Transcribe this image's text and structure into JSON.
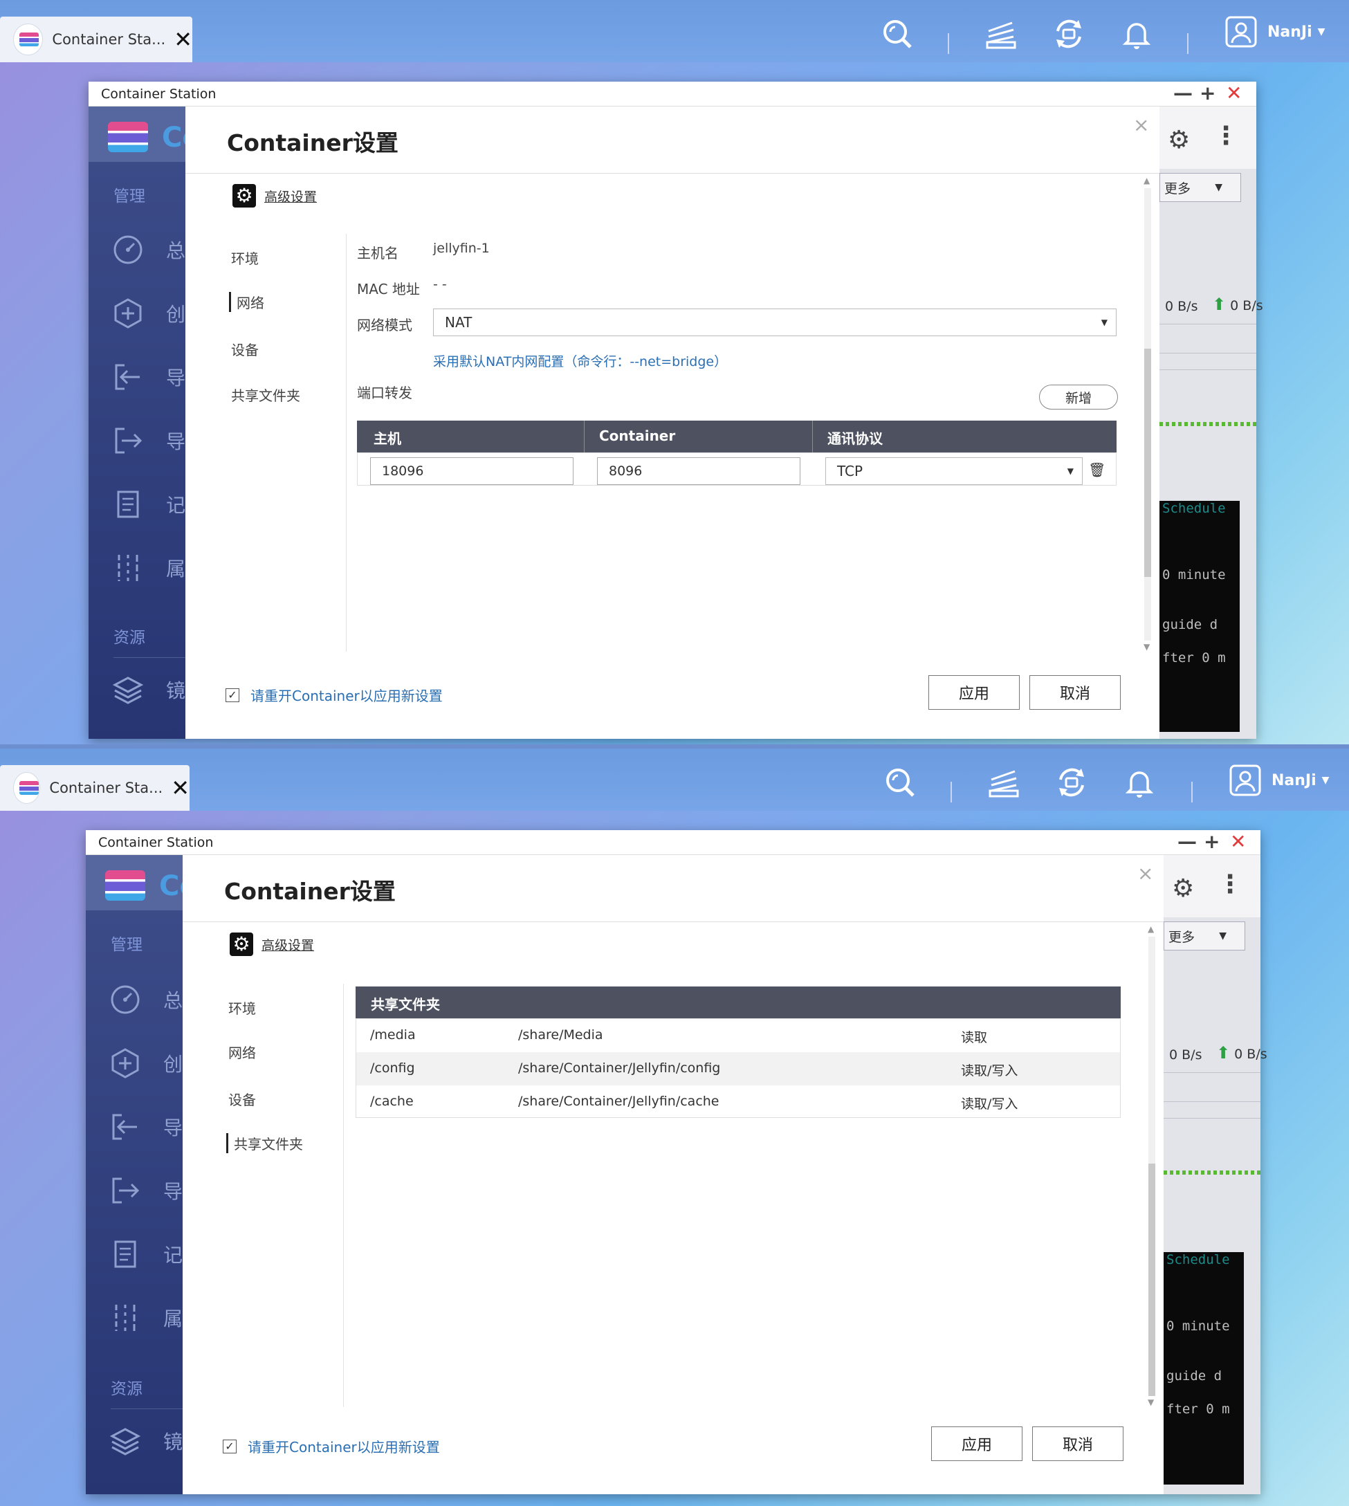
{
  "taskbar": {
    "tab_title": "Container Sta...",
    "tab_close": "✕",
    "user_name": "NanJi",
    "user_caret": "▼"
  },
  "window": {
    "title": "Container Station",
    "minimize": "—",
    "maximize": "+",
    "close": "✕"
  },
  "sidebar": {
    "brand_letter": "Co",
    "section_manage": "管理",
    "section_resource": "资源",
    "items": [
      {
        "label": "总",
        "icon": "dashboard-icon"
      },
      {
        "label": "创",
        "icon": "create-icon"
      },
      {
        "label": "导",
        "icon": "import-icon"
      },
      {
        "label": "导",
        "icon": "export-icon"
      },
      {
        "label": "记",
        "icon": "log-icon"
      },
      {
        "label": "属",
        "icon": "preferences-icon"
      }
    ],
    "resource_item": {
      "label": "镜",
      "icon": "layers-icon"
    }
  },
  "background_panel": {
    "more_label": "更多",
    "more_caret": "▼",
    "rx_rate": "0 B/s",
    "tx_rate": "0 B/s",
    "term_lines": [
      "Schedule",
      "0 minute",
      "guide d",
      "fter 0 m"
    ]
  },
  "modal": {
    "title": "Container设置",
    "close": "×",
    "advanced_label": "高级设置",
    "nav": [
      "环境",
      "网络",
      "设备",
      "共享文件夹"
    ],
    "restart_checkbox": "请重开Container以应用新设置",
    "apply": "应用",
    "cancel": "取消"
  },
  "network": {
    "hostname_label": "主机名",
    "hostname": "jellyfin-1",
    "mac_label": "MAC 地址",
    "mac": "- -",
    "mode_label": "网络模式",
    "mode": "NAT",
    "hint": "采用默认NAT内网配置（命令行：--net=bridge）",
    "port_forward_label": "端口转发",
    "add_button": "新增",
    "columns": [
      "主机",
      "Container",
      "通讯协议"
    ],
    "rows": [
      {
        "host": "18096",
        "container": "8096",
        "protocol": "TCP"
      }
    ]
  },
  "shared_folders": {
    "header": "共享文件夹",
    "rows": [
      {
        "mount": "/media",
        "path": "/share/Media",
        "perm": "读取"
      },
      {
        "mount": "/config",
        "path": "/share/Container/Jellyfin/config",
        "perm": "读取/写入"
      },
      {
        "mount": "/cache",
        "path": "/share/Container/Jellyfin/cache",
        "perm": "读取/写入"
      }
    ]
  }
}
